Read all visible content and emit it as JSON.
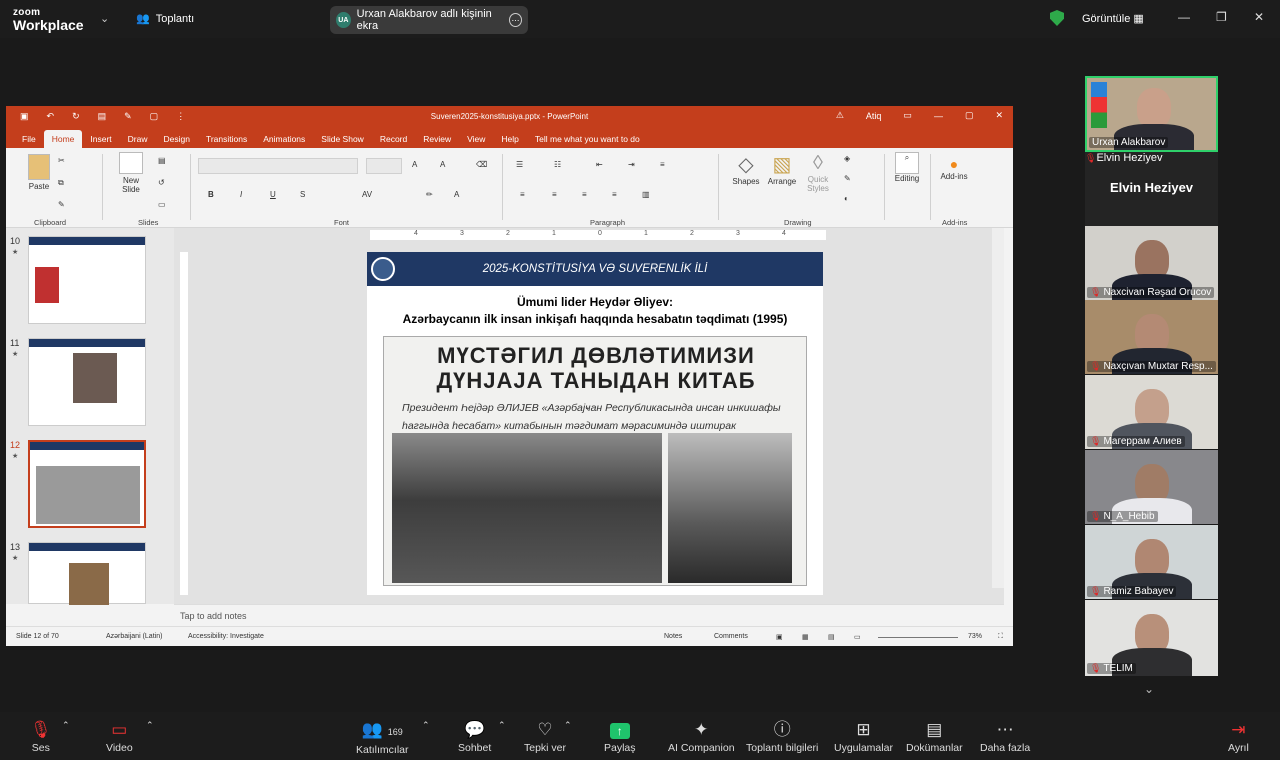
{
  "app": {
    "logo_top": "zoom",
    "logo_bottom": "Workplace",
    "meeting_label": "Toplantı",
    "share_initials": "UA",
    "share_text": "Urxan Alakbarov adlı kişinin ekra",
    "view_label": "Görüntüle"
  },
  "ppt": {
    "title": "Suveren2025-konstitusiya.pptx - PowerPoint",
    "user": "Atiq",
    "tabs": [
      "File",
      "Home",
      "Insert",
      "Draw",
      "Design",
      "Transitions",
      "Animations",
      "Slide Show",
      "Record",
      "Review",
      "View",
      "Help"
    ],
    "tell_me": "Tell me what you want to do",
    "ribbon": {
      "paste": "Paste",
      "new_slide": "New Slide",
      "clipboard": "Clipboard",
      "slides": "Slides",
      "font": "Font",
      "paragraph": "Paragraph",
      "drawing": "Drawing",
      "shapes": "Shapes",
      "arrange": "Arrange",
      "quick_styles": "Quick Styles",
      "editing": "Editing",
      "addins": "Add-ins",
      "addins_grp": "Add-ins"
    },
    "thumbs": [
      {
        "num": "10",
        "star": "★"
      },
      {
        "num": "11",
        "star": "★"
      },
      {
        "num": "12",
        "star": "★"
      },
      {
        "num": "13",
        "star": "★"
      }
    ],
    "slide": {
      "banner": "2025-KONSTİTUSİYA VƏ SUVERENLİK İLİ",
      "title1": "Ümumi lider Heydər Əliyev:",
      "title2": "Azərbaycanın ilk insan inkişafı haqqında hesabatın təqdimatı (1995)",
      "news_line1": "МҮСТƏГИЛ ДӨВЛƏТИМИЗИ",
      "news_line2": "ДҮНЈАЈА ТАНЫДАН КИТАБ",
      "news_sub": "Президент Һејдəр ƏЛИЈЕВ «Азәрбајҹан Республикасында инсан инкишафы һаггында һесабат» китабынын тəгдимат мəрасиминдə иштирак етмишдир"
    },
    "ruler_ticks": [
      "4",
      "3",
      "2",
      "1",
      "0",
      "1",
      "2",
      "3",
      "4"
    ],
    "notes": "Tap to add notes",
    "status": {
      "slide": "Slide 12 of 70",
      "lang": "Azərbaijani (Latin)",
      "access": "Accessibility: Investigate",
      "notes": "Notes",
      "comments": "Comments",
      "zoom": "73%"
    }
  },
  "participants": {
    "presenter": "Urxan Alakbarov",
    "active_name": "Elvin Heziyev",
    "list": [
      "Elvin Heziyev",
      "Naxcivan Rəşad Orucov",
      "Naxçıvan Muxtar Resp...",
      "Магеррам Алиев",
      "N_A_Hebib",
      "Ramiz Babayev",
      "TELIM"
    ]
  },
  "toolbar": {
    "audio": "Ses",
    "video": "Video",
    "participants": "Katılımcılar",
    "participants_count": "169",
    "chat": "Sohbet",
    "react": "Tepki ver",
    "share": "Paylaş",
    "ai": "AI Companion",
    "info": "Toplantı bilgileri",
    "apps": "Uygulamalar",
    "docs": "Dokümanlar",
    "more": "Daha fazla",
    "leave": "Ayrıl"
  },
  "colors": {
    "ppt_accent": "#c43e1c",
    "banner": "#1f3864",
    "share_green": "#1fc46c"
  }
}
